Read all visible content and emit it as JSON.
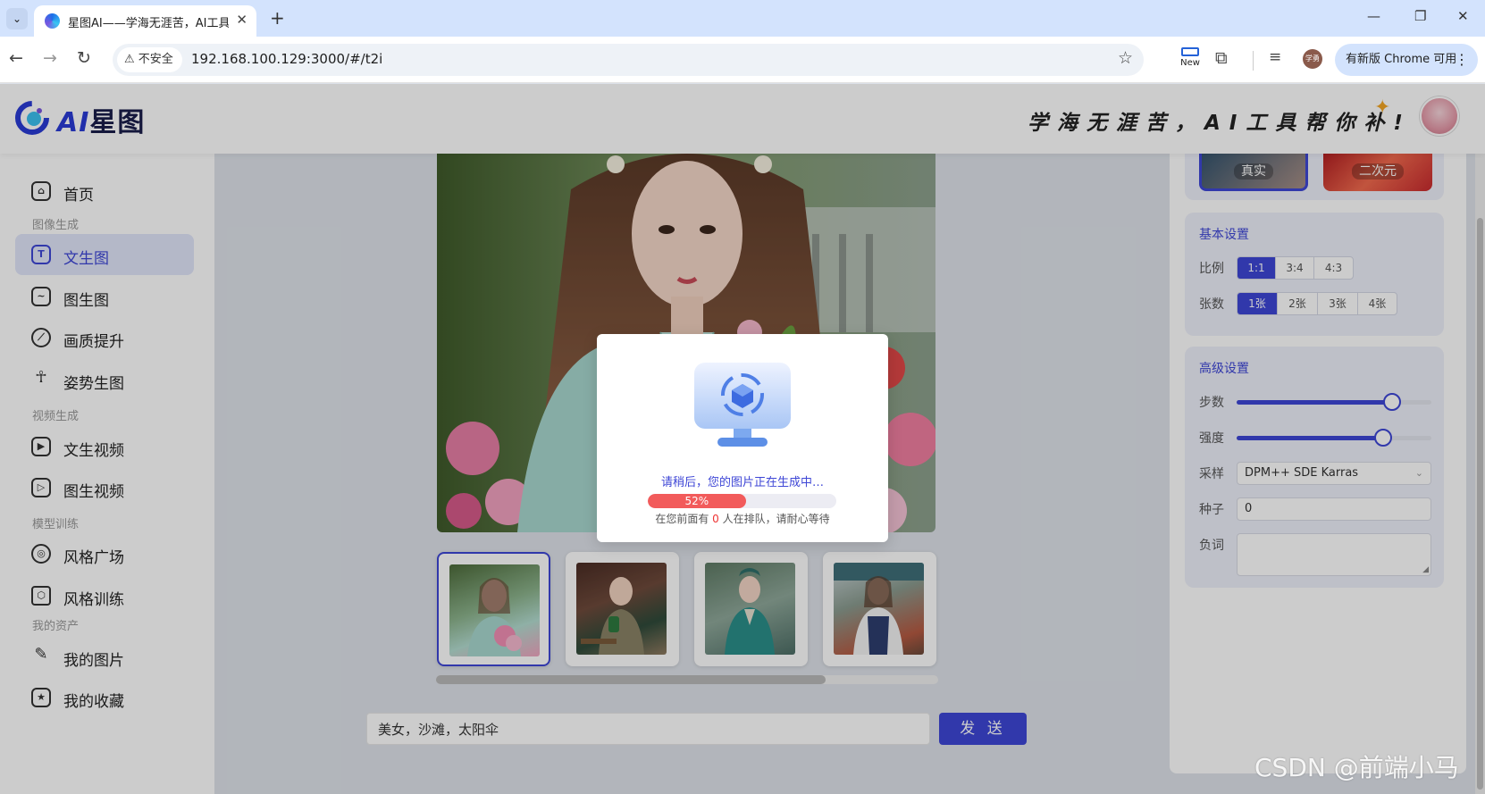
{
  "browser": {
    "tab_title": "星图AI——学海无涯苦，AI工具",
    "security_label": "不安全",
    "url": "192.168.100.129:3000/#/t2i",
    "ext_new_label": "New",
    "profile_label": "学勇",
    "update_label": "有新版 Chrome 可用"
  },
  "header": {
    "logo_ai": "AI",
    "logo_cn": "星图",
    "slogan": "学海无涯苦，AI工具帮你补!"
  },
  "sidebar": {
    "home": "首页",
    "group_image": "图像生成",
    "text2img": "文生图",
    "img2img": "图生图",
    "upscale": "画质提升",
    "pose": "姿势生图",
    "group_video": "视频生成",
    "text2video": "文生视频",
    "img2video": "图生视频",
    "group_train": "模型训练",
    "style_square": "风格广场",
    "style_train": "风格训练",
    "group_assets": "我的资产",
    "my_images": "我的图片",
    "my_favs": "我的收藏"
  },
  "main": {
    "prompt_value": "美女，沙滩，太阳伞",
    "send_label": "发 送"
  },
  "modal": {
    "message": "请稍后，您的图片正在生成中…",
    "progress": 52,
    "progress_label": "52%",
    "queue_prefix": "在您前面有 ",
    "queue_count": "0",
    "queue_suffix": " 人在排队，请耐心等待"
  },
  "panel": {
    "style_real": "真实",
    "style_anime": "二次元",
    "basic_title": "基本设置",
    "ratio_label": "比例",
    "ratios": [
      "1:1",
      "3:4",
      "4:3"
    ],
    "count_label": "张数",
    "counts": [
      "1张",
      "2张",
      "3张",
      "4张"
    ],
    "advanced_title": "高级设置",
    "steps_label": "步数",
    "steps_fraction": 0.8,
    "strength_label": "强度",
    "strength_fraction": 0.75,
    "sampler_label": "采样",
    "sampler_value": "DPM++ SDE Karras",
    "seed_label": "种子",
    "seed_value": "0",
    "negative_label": "负词"
  },
  "watermark": "CSDN @前端小马",
  "colors": {
    "accent": "#3e46d6",
    "progress": "#f25b5b"
  }
}
